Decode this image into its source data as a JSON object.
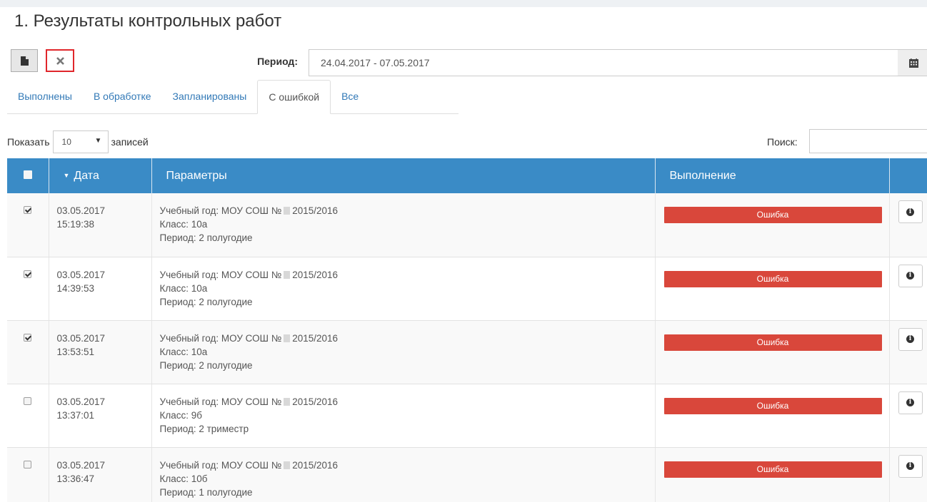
{
  "page": {
    "title": "1. Результаты контрольных работ"
  },
  "toolbar": {
    "file_icon": "file-icon",
    "clear_icon": "close-icon",
    "period_label": "Период:",
    "period_value": "24.04.2017 - 07.05.2017",
    "calendar_icon": "calendar-icon"
  },
  "tabs": [
    {
      "label": "Выполнены",
      "active": false
    },
    {
      "label": "В обработке",
      "active": false
    },
    {
      "label": "Запланированы",
      "active": false
    },
    {
      "label": "С ошибкой",
      "active": true
    },
    {
      "label": "Все",
      "active": false
    }
  ],
  "list_controls": {
    "show_label": "Показать",
    "page_size": "10",
    "records_label": "записей",
    "search_label": "Поиск:",
    "search_value": ""
  },
  "table": {
    "columns": [
      "Дата",
      "Параметры",
      "Выполнение"
    ],
    "rows": [
      {
        "checked": true,
        "date": "03.05.2017",
        "time": "15:19:38",
        "p1": "Учебный год: МОУ СОШ №",
        "year": "2015/2016",
        "p2": "Класс: 10а",
        "p3": "Период: 2 полугодие",
        "status": "Ошибка"
      },
      {
        "checked": true,
        "date": "03.05.2017",
        "time": "14:39:53",
        "p1": "Учебный год: МОУ СОШ №",
        "year": "2015/2016",
        "p2": "Класс: 10а",
        "p3": "Период: 2 полугодие",
        "status": "Ошибка"
      },
      {
        "checked": true,
        "date": "03.05.2017",
        "time": "13:53:51",
        "p1": "Учебный год: МОУ СОШ №",
        "year": "2015/2016",
        "p2": "Класс: 10а",
        "p3": "Период: 2 полугодие",
        "status": "Ошибка"
      },
      {
        "checked": false,
        "date": "03.05.2017",
        "time": "13:37:01",
        "p1": "Учебный год: МОУ СОШ №",
        "year": "2015/2016",
        "p2": "Класс: 9б",
        "p3": "Период: 2 триместр",
        "status": "Ошибка"
      },
      {
        "checked": false,
        "date": "03.05.2017",
        "time": "13:36:47",
        "p1": "Учебный год: МОУ СОШ №",
        "year": "2015/2016",
        "p2": "Класс: 10б",
        "p3": "Период: 1 полугодие",
        "status": "Ошибка"
      }
    ]
  },
  "colors": {
    "header_bg": "#3a8bc6",
    "error": "#d9473b",
    "link": "#3279b7",
    "highlight_border": "#e0262b"
  }
}
